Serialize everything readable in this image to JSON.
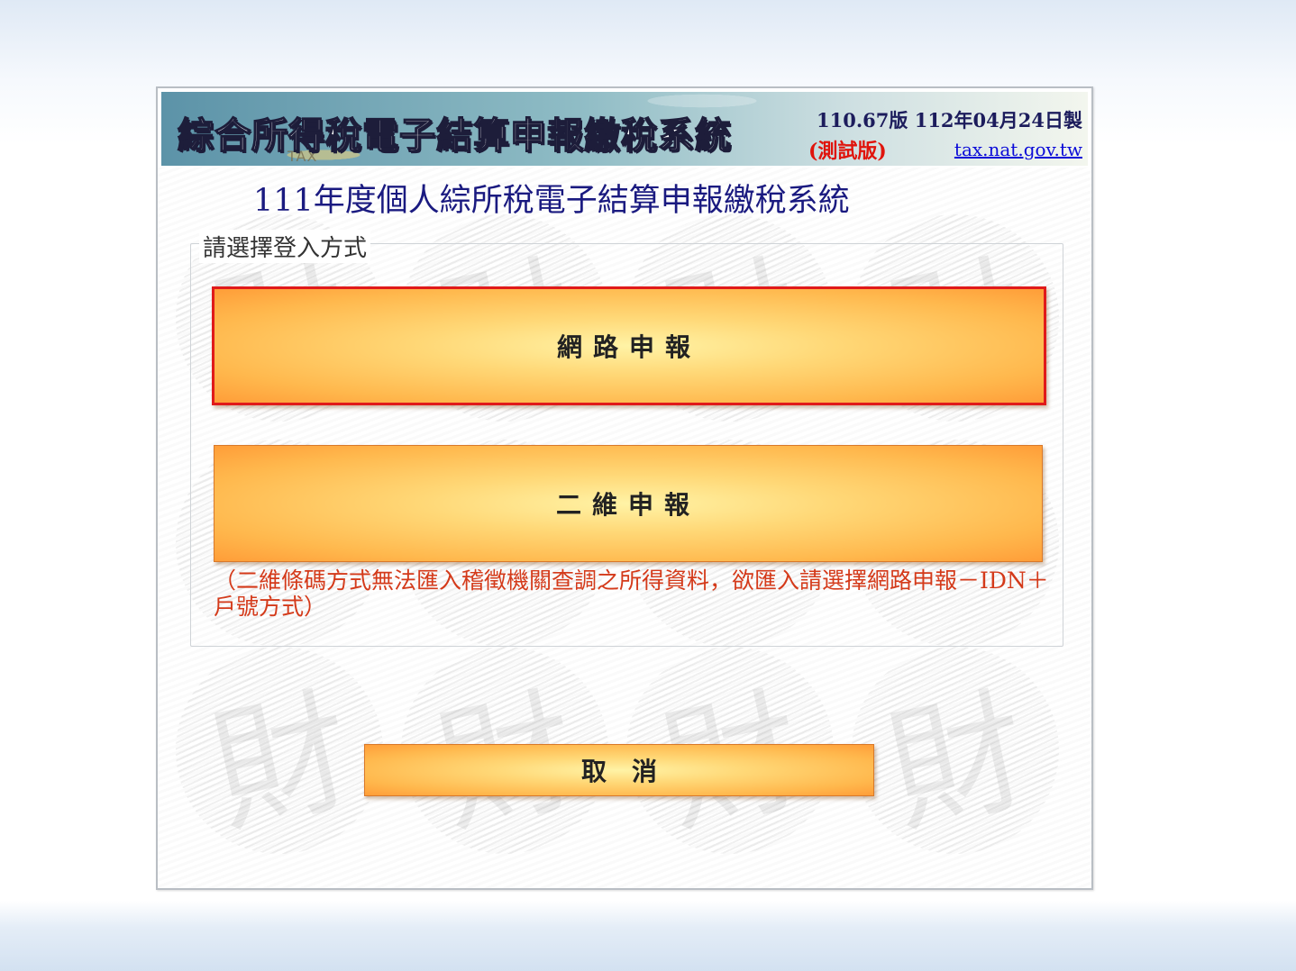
{
  "header": {
    "banner_title": "綜合所得稅電子結算申報繳稅系統",
    "version": "110.67版  112年04月24日製",
    "test_label": "(測試版)",
    "website_link": "tax.nat.gov.tw",
    "banner_badge": "TAX"
  },
  "main": {
    "system_title": "111年度個人綜所稅電子結算申報繳稅系統",
    "login_group": {
      "legend": "請選擇登入方式",
      "network_button_label": "網路申報",
      "qr_button_label": "二維申報",
      "qr_note": "（二維條碼方式無法匯入稽徵機關查調之所得資料，欲匯入請選擇網路申報－IDN＋戶號方式）"
    },
    "cancel_button_label": "取　消"
  },
  "colors": {
    "title_navy": "#1a1a80",
    "note_red": "#d43a1a",
    "selected_border": "#e01a1a",
    "button_orange": "#ffb84d",
    "link_blue": "#0b0bd8"
  },
  "watermark_glyph": "財"
}
